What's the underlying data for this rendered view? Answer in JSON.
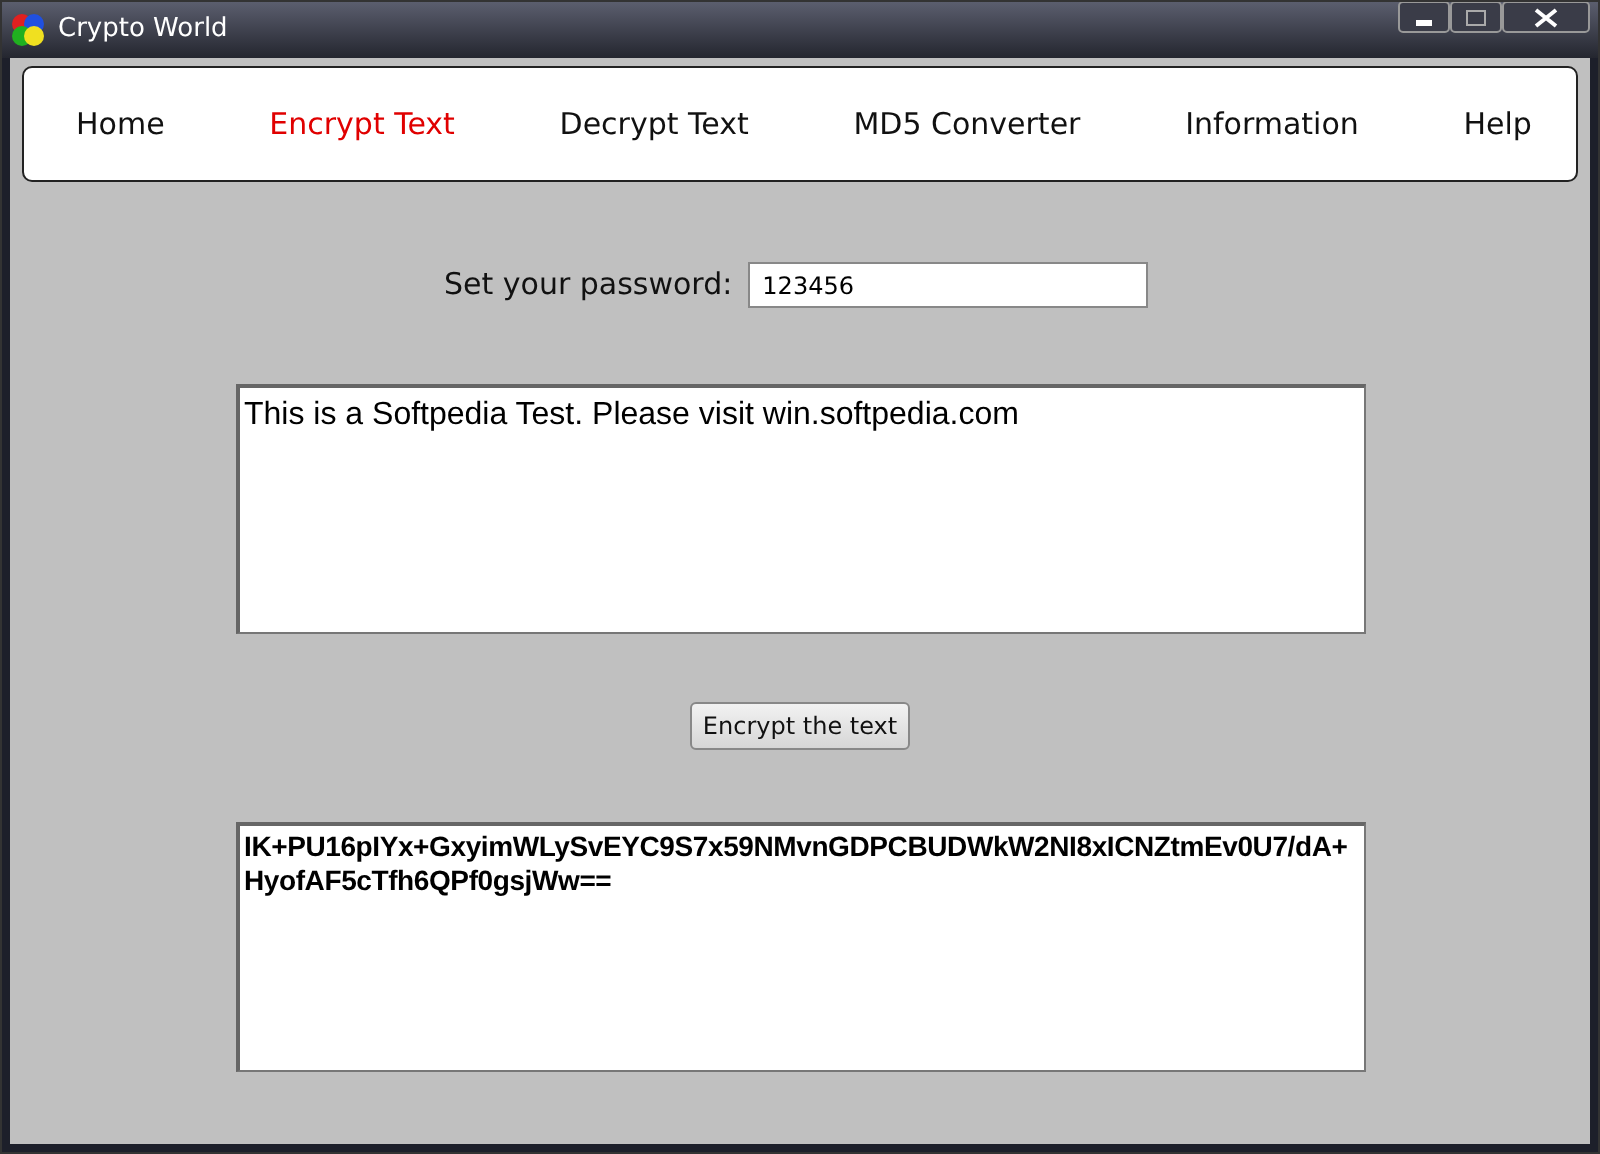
{
  "window": {
    "title": "Crypto World"
  },
  "nav": [
    {
      "label": "Home",
      "selected": false
    },
    {
      "label": "Encrypt Text",
      "selected": true
    },
    {
      "label": "Decrypt Text",
      "selected": false
    },
    {
      "label": "MD5 Converter",
      "selected": false
    },
    {
      "label": "Information",
      "selected": false
    },
    {
      "label": "Help",
      "selected": false
    }
  ],
  "password": {
    "label": "Set your password:",
    "value": "123456"
  },
  "input_text": "This is a Softpedia Test. Please visit win.softpedia.com",
  "button": "Encrypt the text",
  "output_text": "IK+PU16pIYx+GxyimWLySvEYC9S7x59NMvnGDPCBUDWkW2NI8xICNZtmEv0U7/dA+HyofAF5cTfh6QPf0gsjWw=="
}
